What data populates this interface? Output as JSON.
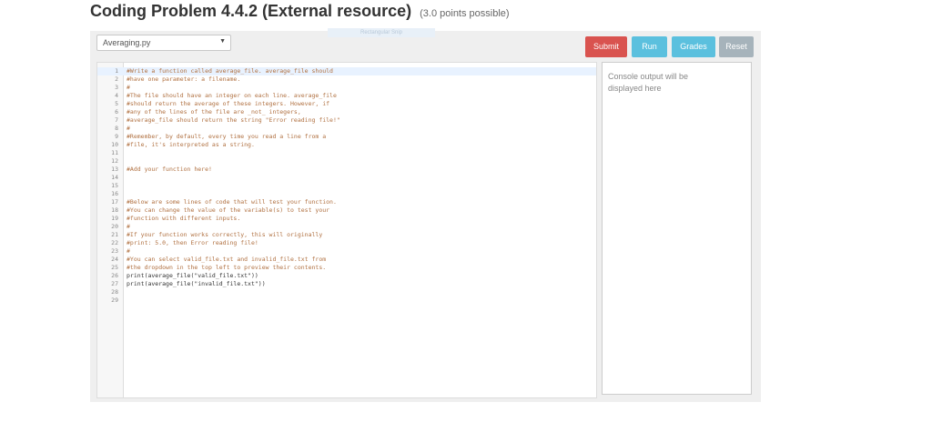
{
  "page": {
    "title": "Coding Problem 4.4.2 (External resource)",
    "points": "(3.0 points possible)",
    "ghost_tab_label": "Rectangular Snip"
  },
  "toolbar": {
    "file_select_value": "Averaging.py",
    "submit_label": "Submit",
    "run_label": "Run",
    "grades_label": "Grades",
    "reset_label": "Reset"
  },
  "editor": {
    "lines": [
      {
        "num": "1",
        "text": "#Write a function called average_file. average_file should",
        "kind": "comment"
      },
      {
        "num": "2",
        "text": "#have one parameter: a filename.",
        "kind": "comment"
      },
      {
        "num": "3",
        "text": "#",
        "kind": "comment"
      },
      {
        "num": "4",
        "text": "#The file should have an integer on each line. average_file",
        "kind": "comment"
      },
      {
        "num": "5",
        "text": "#should return the average of these integers. However, if",
        "kind": "comment"
      },
      {
        "num": "6",
        "text": "#any of the lines of the file are _not_ integers,",
        "kind": "comment"
      },
      {
        "num": "7",
        "text": "#average_file should return the string \"Error reading file!\"",
        "kind": "comment"
      },
      {
        "num": "8",
        "text": "#",
        "kind": "comment"
      },
      {
        "num": "9",
        "text": "#Remember, by default, every time you read a line from a",
        "kind": "comment"
      },
      {
        "num": "10",
        "text": "#file, it's interpreted as a string.",
        "kind": "comment"
      },
      {
        "num": "11",
        "text": "",
        "kind": "blank"
      },
      {
        "num": "12",
        "text": "",
        "kind": "blank"
      },
      {
        "num": "13",
        "text": "#Add your function here!",
        "kind": "comment"
      },
      {
        "num": "14",
        "text": "",
        "kind": "blank"
      },
      {
        "num": "15",
        "text": "",
        "kind": "blank"
      },
      {
        "num": "16",
        "text": "",
        "kind": "blank"
      },
      {
        "num": "17",
        "text": "#Below are some lines of code that will test your function.",
        "kind": "comment"
      },
      {
        "num": "18",
        "text": "#You can change the value of the variable(s) to test your",
        "kind": "comment"
      },
      {
        "num": "19",
        "text": "#function with different inputs.",
        "kind": "comment"
      },
      {
        "num": "20",
        "text": "#",
        "kind": "comment"
      },
      {
        "num": "21",
        "text": "#If your function works correctly, this will originally",
        "kind": "comment"
      },
      {
        "num": "22",
        "text": "#print: 5.0, then Error reading file!",
        "kind": "comment"
      },
      {
        "num": "23",
        "text": "#",
        "kind": "comment"
      },
      {
        "num": "24",
        "text": "#You can select valid_file.txt and invalid_file.txt from",
        "kind": "comment"
      },
      {
        "num": "25",
        "text": "#the dropdown in the top left to preview their contents.",
        "kind": "comment"
      },
      {
        "num": "26",
        "text": "print(average_file(\"valid_file.txt\"))",
        "kind": "code"
      },
      {
        "num": "27",
        "text": "print(average_file(\"invalid_file.txt\"))",
        "kind": "code"
      },
      {
        "num": "28",
        "text": "",
        "kind": "blank"
      },
      {
        "num": "29",
        "text": "",
        "kind": "blank"
      }
    ]
  },
  "console": {
    "placeholder": "Console output will be displayed here"
  },
  "colors": {
    "submit": "#d9534f",
    "run": "#5bc0de",
    "grades": "#5bc0de",
    "reset": "#a6b3bb",
    "comment": "#b07040"
  }
}
